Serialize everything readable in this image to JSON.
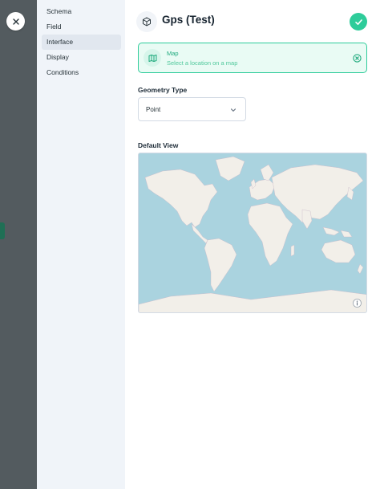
{
  "sidebar": {
    "items": [
      {
        "label": "Schema"
      },
      {
        "label": "Field"
      },
      {
        "label": "Interface",
        "active": true
      },
      {
        "label": "Display"
      },
      {
        "label": "Conditions"
      }
    ]
  },
  "header": {
    "title": "Gps (Test)",
    "icon": "cube-icon"
  },
  "notice": {
    "title": "Map",
    "subtitle": "Select a location on a map",
    "icon": "map-icon"
  },
  "geometry": {
    "label": "Geometry Type",
    "value": "Point"
  },
  "default_view": {
    "label": "Default View"
  },
  "colors": {
    "accent": "#2ecc9a",
    "rail": "#535b5f",
    "sidebar": "#f0f4f9",
    "water": "#aad3df",
    "land": "#f2efe9"
  }
}
